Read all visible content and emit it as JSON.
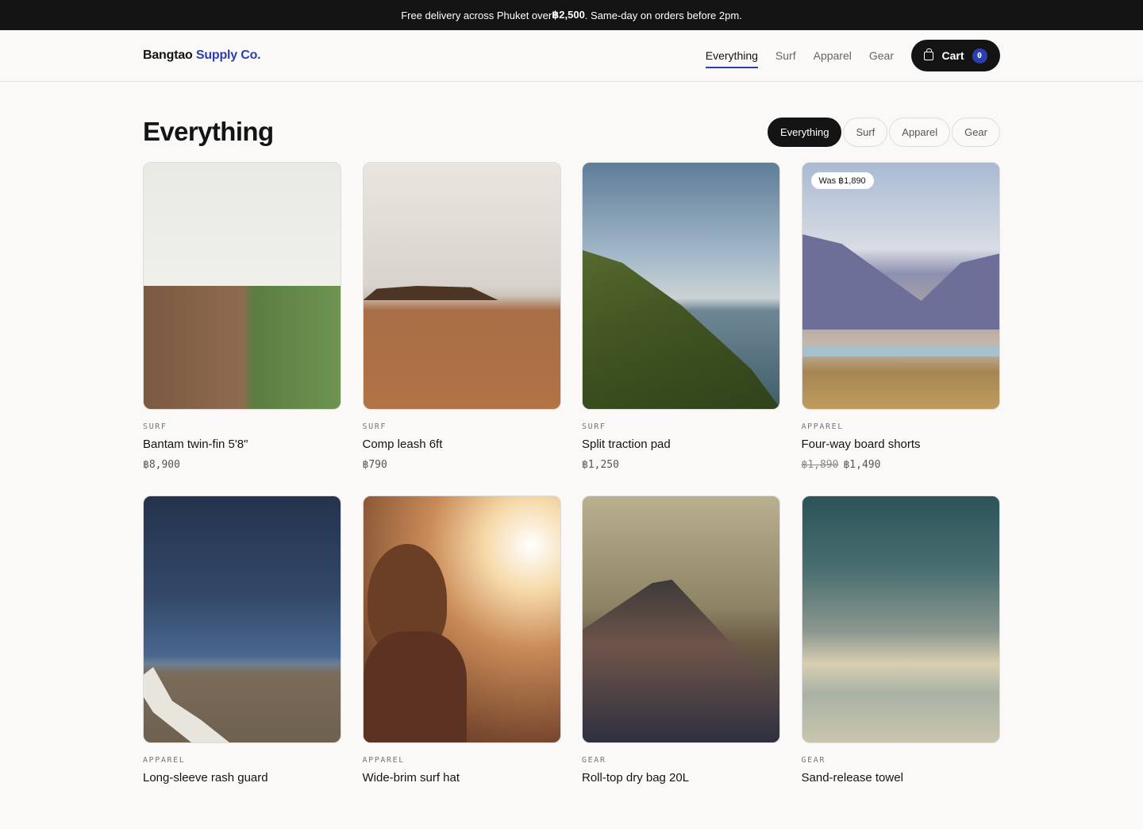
{
  "announcement": {
    "prefix": "Free delivery across Phuket over ",
    "amount": "฿2,500",
    "suffix": ". Same-day on orders before 2pm."
  },
  "brand": {
    "name": "Bangtao",
    "accent": "Supply Co."
  },
  "nav": {
    "items": [
      "Everything",
      "Surf",
      "Apparel",
      "Gear"
    ],
    "active": "Everything",
    "cart_label": "Cart",
    "cart_count": "0"
  },
  "page": {
    "title": "Everything"
  },
  "filters": {
    "items": [
      "Everything",
      "Surf",
      "Apparel",
      "Gear"
    ],
    "active": "Everything"
  },
  "products": [
    {
      "category": "SURF",
      "name": "Bantam twin-fin 5'8\"",
      "price": "฿8,900",
      "old_price": "",
      "badge": ""
    },
    {
      "category": "SURF",
      "name": "Comp leash 6ft",
      "price": "฿790",
      "old_price": "",
      "badge": ""
    },
    {
      "category": "SURF",
      "name": "Split traction pad",
      "price": "฿1,250",
      "old_price": "",
      "badge": ""
    },
    {
      "category": "APPAREL",
      "name": "Four-way board shorts",
      "price": "฿1,490",
      "old_price": "฿1,890",
      "badge": "Was ฿1,890"
    },
    {
      "category": "APPAREL",
      "name": "Long-sleeve rash guard",
      "price": "",
      "old_price": "",
      "badge": ""
    },
    {
      "category": "APPAREL",
      "name": "Wide-brim surf hat",
      "price": "",
      "old_price": "",
      "badge": ""
    },
    {
      "category": "GEAR",
      "name": "Roll-top dry bag 20L",
      "price": "",
      "old_price": "",
      "badge": ""
    },
    {
      "category": "GEAR",
      "name": "Sand-release towel",
      "price": "",
      "old_price": "",
      "badge": ""
    }
  ],
  "colors": {
    "accent": "#2c3fb1",
    "dark": "#141414",
    "background": "#faf9f7"
  }
}
